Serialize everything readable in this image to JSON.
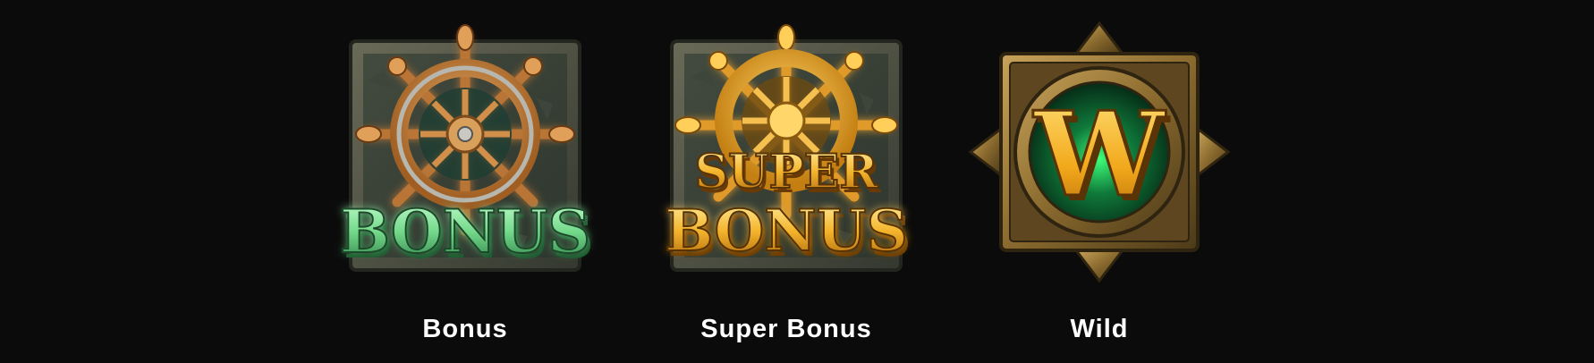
{
  "symbols": [
    {
      "label": "Bonus",
      "icon": "ships-wheel-bonus-icon",
      "text": "BONUS",
      "accent": "#6fd98a"
    },
    {
      "label": "Super Bonus",
      "icon": "ships-wheel-super-bonus-icon",
      "text": [
        "SUPER",
        "BONUS"
      ],
      "accent": "#f0b02a"
    },
    {
      "label": "Wild",
      "icon": "wild-w-emblem-icon",
      "text": "W",
      "accent": "#f5b91e"
    }
  ],
  "colors": {
    "background": "#0b0b0b",
    "label": "#ffffff",
    "stone": "#4f5145",
    "glow_green": "#3cff6a",
    "wood": "#c98a44",
    "gold": "#f0b02a",
    "bronze": "#9a7a3e"
  }
}
